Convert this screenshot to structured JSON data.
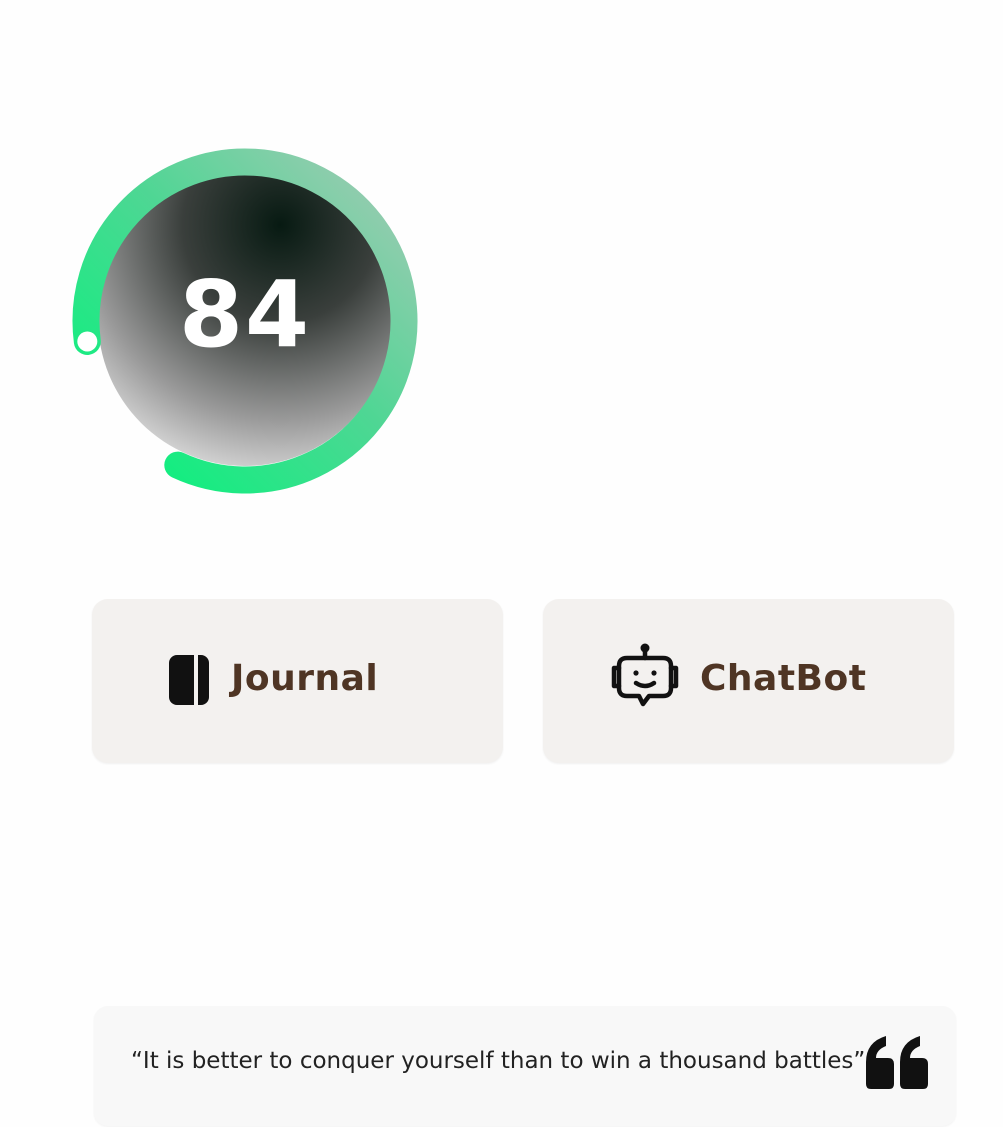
{
  "score": {
    "value": "84",
    "progress": 0.84
  },
  "actions": [
    {
      "label": "Journal",
      "icon": "journal-icon"
    },
    {
      "label": "ChatBot",
      "icon": "robot-icon"
    }
  ],
  "quote": {
    "text": "“It is better to conquer yourself than to win a thousand battles”",
    "icon": "quote-mark-icon"
  },
  "colors": {
    "ring_start": "#00f57a",
    "ring_end": "#9ac9b0",
    "label_brown": "#4f3524",
    "card_bg": "#f3f1ef"
  }
}
